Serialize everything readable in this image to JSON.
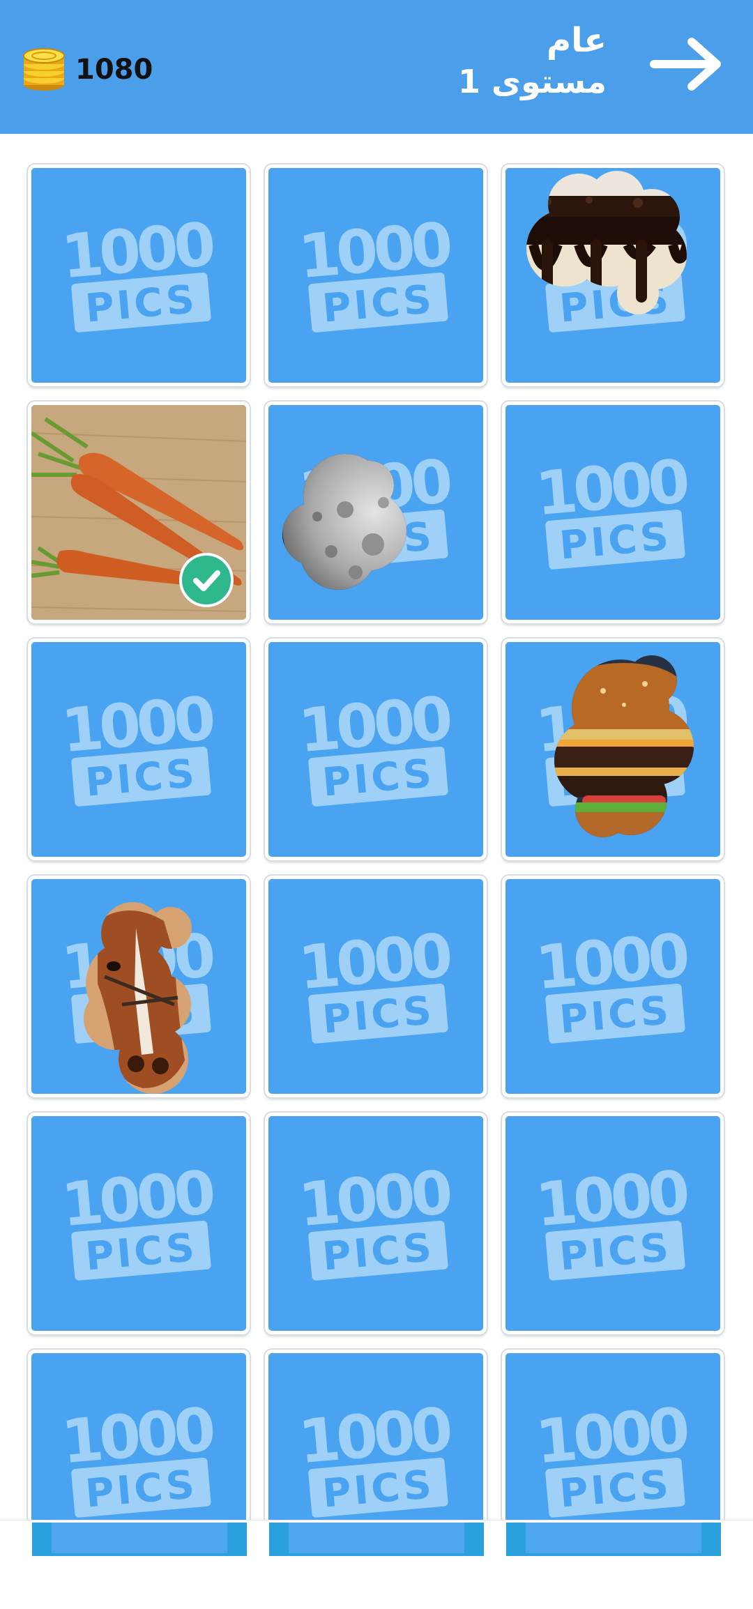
{
  "header": {
    "coins": "1080",
    "category": "عام",
    "level": "مستوى 1",
    "coin_icon": "coin-stack-icon",
    "next_icon": "arrow-right-icon"
  },
  "colors": {
    "header_bg": "#4a9eea",
    "tile_bg": "#4aa3f0",
    "logo_fill": "#9fd0f7",
    "check_badge": "#2fb88e",
    "coin_gold": "#f5c21a"
  },
  "logo": {
    "top": "1000",
    "bottom": "PICS"
  },
  "tiles": [
    {
      "state": "locked"
    },
    {
      "state": "locked"
    },
    {
      "state": "partial",
      "image": "chocolate-cake"
    },
    {
      "state": "solved",
      "image": "carrots"
    },
    {
      "state": "partial",
      "image": "moon"
    },
    {
      "state": "locked"
    },
    {
      "state": "locked"
    },
    {
      "state": "locked"
    },
    {
      "state": "partial",
      "image": "burger"
    },
    {
      "state": "partial",
      "image": "horse"
    },
    {
      "state": "locked"
    },
    {
      "state": "locked"
    },
    {
      "state": "locked"
    },
    {
      "state": "locked"
    },
    {
      "state": "locked"
    },
    {
      "state": "locked"
    },
    {
      "state": "locked"
    },
    {
      "state": "locked"
    }
  ]
}
